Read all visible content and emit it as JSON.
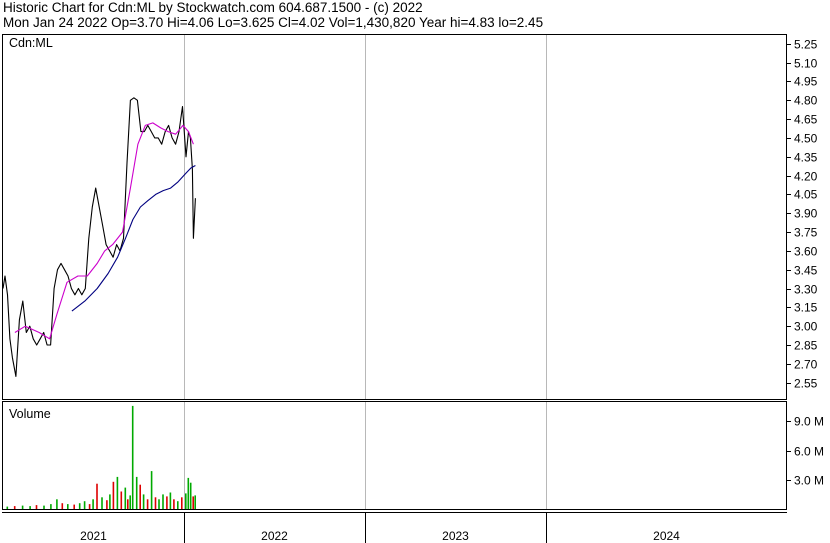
{
  "header": {
    "line1": "Historic Chart for Cdn:ML by Stockwatch.com 604.687.1500 - (c) 2022",
    "line2": "Mon Jan 24 2022  Op=3.70  Hi=4.06  Lo=3.625  Cl=4.02  Vol=1,430,820  Year hi=4.83  lo=2.45"
  },
  "chart_data": [
    {
      "type": "line",
      "title": "Cdn:ML",
      "ylim": [
        2.42,
        5.32
      ],
      "y_ticks": [
        "5.25",
        "5.10",
        "4.95",
        "4.80",
        "4.65",
        "4.50",
        "4.35",
        "4.20",
        "4.05",
        "3.90",
        "3.75",
        "3.60",
        "3.45",
        "3.30",
        "3.15",
        "3.00",
        "2.85",
        "2.70",
        "2.55"
      ],
      "x_tick_labels": [
        "2021",
        "2022",
        "2023",
        "2024"
      ],
      "grid": true,
      "colors": {
        "price": "#000000",
        "ma_short": "#cc00cc",
        "ma_long": "#000080"
      },
      "series": [
        {
          "key": "price",
          "x": [
            "2021-01-01",
            "2021-01-05",
            "2021-01-10",
            "2021-01-15",
            "2021-01-20",
            "2021-01-27",
            "2021-02-03",
            "2021-02-10",
            "2021-02-17",
            "2021-02-24",
            "2021-03-03",
            "2021-03-10",
            "2021-03-17",
            "2021-03-24",
            "2021-03-31",
            "2021-04-07",
            "2021-04-14",
            "2021-04-21",
            "2021-04-28",
            "2021-05-05",
            "2021-05-12",
            "2021-05-19",
            "2021-05-26",
            "2021-06-02",
            "2021-06-09",
            "2021-06-16",
            "2021-06-23",
            "2021-06-30",
            "2021-07-07",
            "2021-07-14",
            "2021-07-21",
            "2021-07-28",
            "2021-08-04",
            "2021-08-11",
            "2021-08-18",
            "2021-08-25",
            "2021-09-01",
            "2021-09-08",
            "2021-09-15",
            "2021-09-22",
            "2021-09-29",
            "2021-10-06",
            "2021-10-13",
            "2021-10-20",
            "2021-10-27",
            "2021-11-03",
            "2021-11-10",
            "2021-11-17",
            "2021-11-24",
            "2021-12-01",
            "2021-12-08",
            "2021-12-15",
            "2021-12-22",
            "2021-12-29",
            "2022-01-05",
            "2022-01-10",
            "2022-01-14",
            "2022-01-18",
            "2022-01-20",
            "2022-01-24"
          ],
          "values": [
            3.3,
            3.4,
            3.25,
            2.9,
            2.75,
            2.6,
            3.05,
            3.2,
            2.95,
            3.0,
            2.9,
            2.85,
            2.9,
            2.95,
            2.85,
            2.85,
            3.3,
            3.45,
            3.5,
            3.45,
            3.4,
            3.3,
            3.25,
            3.3,
            3.25,
            3.3,
            3.7,
            3.95,
            4.1,
            3.95,
            3.8,
            3.65,
            3.6,
            3.55,
            3.65,
            3.6,
            3.7,
            4.3,
            4.8,
            4.82,
            4.8,
            4.55,
            4.55,
            4.6,
            4.55,
            4.5,
            4.5,
            4.45,
            4.55,
            4.6,
            4.5,
            4.45,
            4.55,
            4.75,
            4.35,
            4.55,
            4.5,
            4.25,
            3.7,
            4.02
          ]
        },
        {
          "key": "ma_short",
          "x": [
            "2021-01-25",
            "2021-02-15",
            "2021-03-15",
            "2021-04-05",
            "2021-04-20",
            "2021-05-10",
            "2021-06-01",
            "2021-06-20",
            "2021-07-10",
            "2021-07-25",
            "2021-08-10",
            "2021-08-30",
            "2021-09-15",
            "2021-09-30",
            "2021-10-15",
            "2021-10-30",
            "2021-11-15",
            "2021-11-30",
            "2021-12-15",
            "2021-12-30",
            "2022-01-10",
            "2022-01-20"
          ],
          "values": [
            2.95,
            3.0,
            2.95,
            2.9,
            3.1,
            3.35,
            3.4,
            3.4,
            3.5,
            3.6,
            3.65,
            3.75,
            4.1,
            4.45,
            4.6,
            4.62,
            4.58,
            4.55,
            4.53,
            4.6,
            4.55,
            4.45
          ]
        },
        {
          "key": "ma_long",
          "x": [
            "2021-05-20",
            "2021-06-15",
            "2021-07-10",
            "2021-08-01",
            "2021-08-20",
            "2021-09-05",
            "2021-09-20",
            "2021-10-05",
            "2021-10-20",
            "2021-11-05",
            "2021-11-20",
            "2021-12-05",
            "2021-12-20",
            "2022-01-05",
            "2022-01-15",
            "2022-01-24"
          ],
          "values": [
            3.12,
            3.2,
            3.3,
            3.42,
            3.55,
            3.7,
            3.85,
            3.95,
            4.0,
            4.05,
            4.08,
            4.1,
            4.15,
            4.22,
            4.26,
            4.28
          ]
        }
      ]
    },
    {
      "type": "bar",
      "title": "Volume",
      "ylim": [
        0,
        11.0
      ],
      "y_ticks": [
        "9.0 M",
        "6.0 M",
        "3.0 M"
      ],
      "colors": {
        "up": "#00aa00",
        "down": "#dd0000"
      },
      "x": [
        "2021-01-10",
        "2021-01-25",
        "2021-02-10",
        "2021-02-25",
        "2021-03-10",
        "2021-03-25",
        "2021-04-08",
        "2021-04-20",
        "2021-05-01",
        "2021-05-12",
        "2021-05-25",
        "2021-06-05",
        "2021-06-15",
        "2021-06-25",
        "2021-07-02",
        "2021-07-10",
        "2021-07-20",
        "2021-07-30",
        "2021-08-05",
        "2021-08-12",
        "2021-08-20",
        "2021-08-28",
        "2021-09-05",
        "2021-09-10",
        "2021-09-15",
        "2021-09-20",
        "2021-09-28",
        "2021-10-05",
        "2021-10-12",
        "2021-10-20",
        "2021-10-28",
        "2021-11-05",
        "2021-11-12",
        "2021-11-20",
        "2021-11-28",
        "2021-12-05",
        "2021-12-12",
        "2021-12-20",
        "2021-12-28",
        "2022-01-05",
        "2022-01-10",
        "2022-01-15",
        "2022-01-20",
        "2022-01-24"
      ],
      "values": [
        0.25,
        0.3,
        0.35,
        0.3,
        0.4,
        0.35,
        0.5,
        1.0,
        0.6,
        0.5,
        0.45,
        0.6,
        0.8,
        0.5,
        1.0,
        2.6,
        1.2,
        0.9,
        1.5,
        2.8,
        3.3,
        1.8,
        2.2,
        1.0,
        1.4,
        10.6,
        3.3,
        2.5,
        1.5,
        1.0,
        3.9,
        1.2,
        1.0,
        1.5,
        1.3,
        1.7,
        1.0,
        0.8,
        1.2,
        1.6,
        3.2,
        2.7,
        1.3,
        1.4
      ],
      "up": [
        true,
        false,
        true,
        true,
        false,
        true,
        true,
        true,
        false,
        true,
        false,
        true,
        true,
        false,
        true,
        false,
        true,
        false,
        true,
        false,
        true,
        false,
        true,
        false,
        true,
        true,
        true,
        false,
        true,
        false,
        true,
        false,
        true,
        true,
        false,
        true,
        false,
        true,
        false,
        true,
        true,
        true,
        false,
        true
      ]
    }
  ]
}
